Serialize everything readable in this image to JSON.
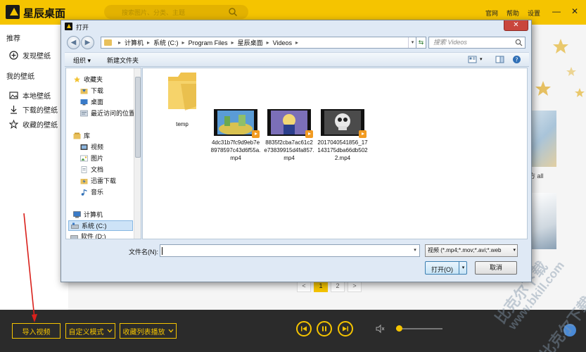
{
  "app": {
    "title": "星辰桌面",
    "search_placeholder": "搜索图片、分类、主题",
    "links": [
      "官网",
      "帮助",
      "设置"
    ],
    "window_controls": [
      "—",
      "✕"
    ],
    "brand_color": "#f5c400"
  },
  "sidebar": {
    "recommend_head": "推荐",
    "discover": "发现壁纸",
    "mine_head": "我的壁纸",
    "local": "本地壁纸",
    "downloaded": "下载的壁纸",
    "favorites": "收藏的壁纸"
  },
  "content": {
    "thumb_label": "方 all",
    "pages": [
      "<",
      "1",
      "2",
      ">"
    ],
    "active_page": "1"
  },
  "bottom": {
    "import_video": "导入视频",
    "custom_mode": "自定义模式",
    "favorites_play": "收藏列表播放",
    "volume_level": 0.06
  },
  "watermark": {
    "line1": "比克尔下载",
    "line2": "www.bkill.com",
    "line3": "比克尔下载"
  },
  "dialog": {
    "title": "打开",
    "close": "✕",
    "path": [
      "计算机",
      "系统 (C:)",
      "Program Files",
      "星辰桌面",
      "Videos"
    ],
    "search_placeholder": "搜索 Videos",
    "toolbar": {
      "organize": "组织 ▾",
      "new_folder": "新建文件夹"
    },
    "nav": {
      "favorites": "收藏夹",
      "download": "下载",
      "desktop": "桌面",
      "recent": "最近访问的位置",
      "library": "库",
      "video": "视频",
      "pictures": "图片",
      "documents": "文档",
      "thunder": "迅雷下载",
      "music": "音乐",
      "computer": "计算机",
      "system_c": "系统 (C:)",
      "software_d": "软件 (D:)"
    },
    "files": [
      {
        "name": "temp",
        "kind": "folder"
      },
      {
        "name": "4dc31b7fc9d9eb7e8978597c43d6f55a.mp4",
        "kind": "video"
      },
      {
        "name": "8835f2cba7ac61c2e73839915d4fa857.mp4",
        "kind": "video"
      },
      {
        "name": "2017040541856_17143175dba66db5022.mp4",
        "kind": "video"
      }
    ],
    "filename_label": "文件名(N):",
    "filename_value": "",
    "filetype": "视频 (*.mp4;*.mov;*.avi;*.web",
    "open_button": "打开(O)",
    "cancel_button": "取消"
  }
}
